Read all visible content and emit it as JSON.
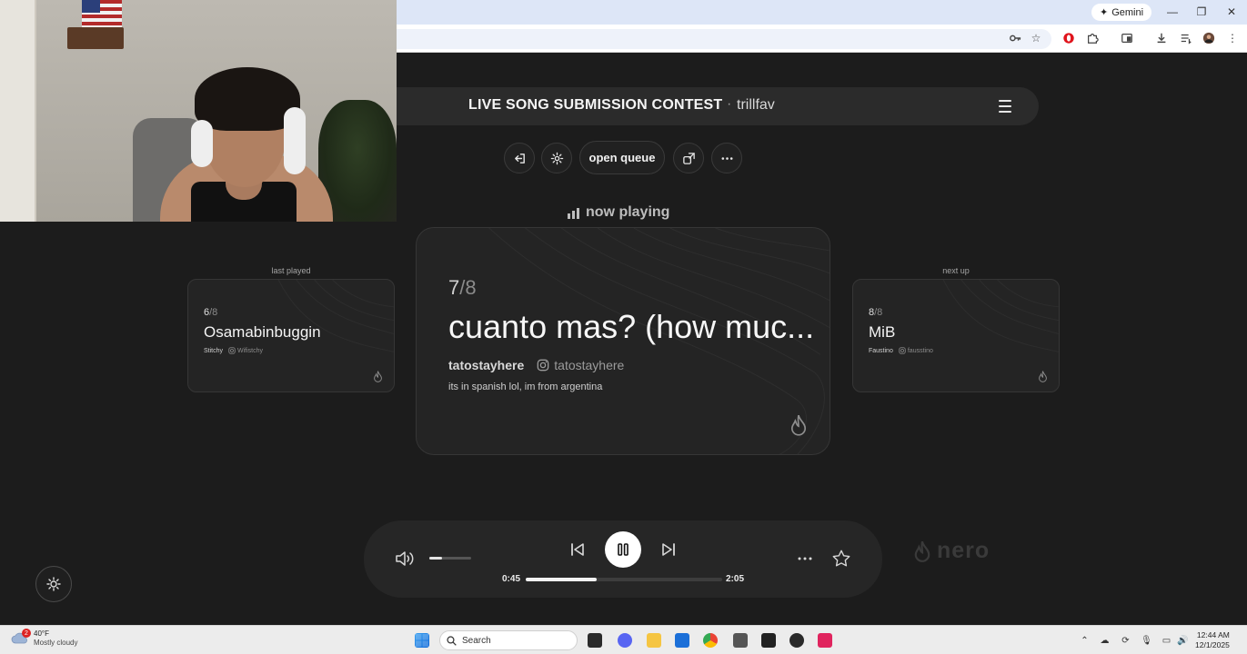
{
  "browser": {
    "gemini_label": "Gemini",
    "window_controls": [
      "minimize",
      "restore",
      "close"
    ]
  },
  "header": {
    "title": "LIVE SONG SUBMISSION CONTEST",
    "separator": "·",
    "username": "trillfav"
  },
  "actions": {
    "queue_label": "open queue"
  },
  "now_playing": {
    "label": "now playing",
    "position": "7",
    "total": "/8",
    "title": "cuanto mas? (how muc...",
    "artist": "tatostayhere",
    "instagram": "tatostayhere",
    "note": "its in spanish lol, im from argentina"
  },
  "last_played": {
    "label": "last played",
    "position": "6",
    "total": "/8",
    "title": "Osamabinbuggin",
    "artist": "Stitchy",
    "instagram": "Wifistchy"
  },
  "next_up": {
    "label": "next up",
    "position": "8",
    "total": "/8",
    "title": "MiB",
    "artist": "Faustino",
    "instagram": "fausstino"
  },
  "player": {
    "elapsed": "0:45",
    "duration": "2:05",
    "progress_fraction": 0.36,
    "volume_fraction": 0.3,
    "state": "playing"
  },
  "brand": {
    "name": "nero"
  },
  "taskbar": {
    "weather_temp": "40°F",
    "weather_desc": "Mostly cloudy",
    "weather_badge": "2",
    "search_label": "Search",
    "time": "12:44 AM",
    "date": "12/1/2025"
  },
  "colors": {
    "background": "#1c1c1c",
    "card": "#242424",
    "accent": "#ffffff",
    "browser_tab_strip": "#dde6f7"
  }
}
